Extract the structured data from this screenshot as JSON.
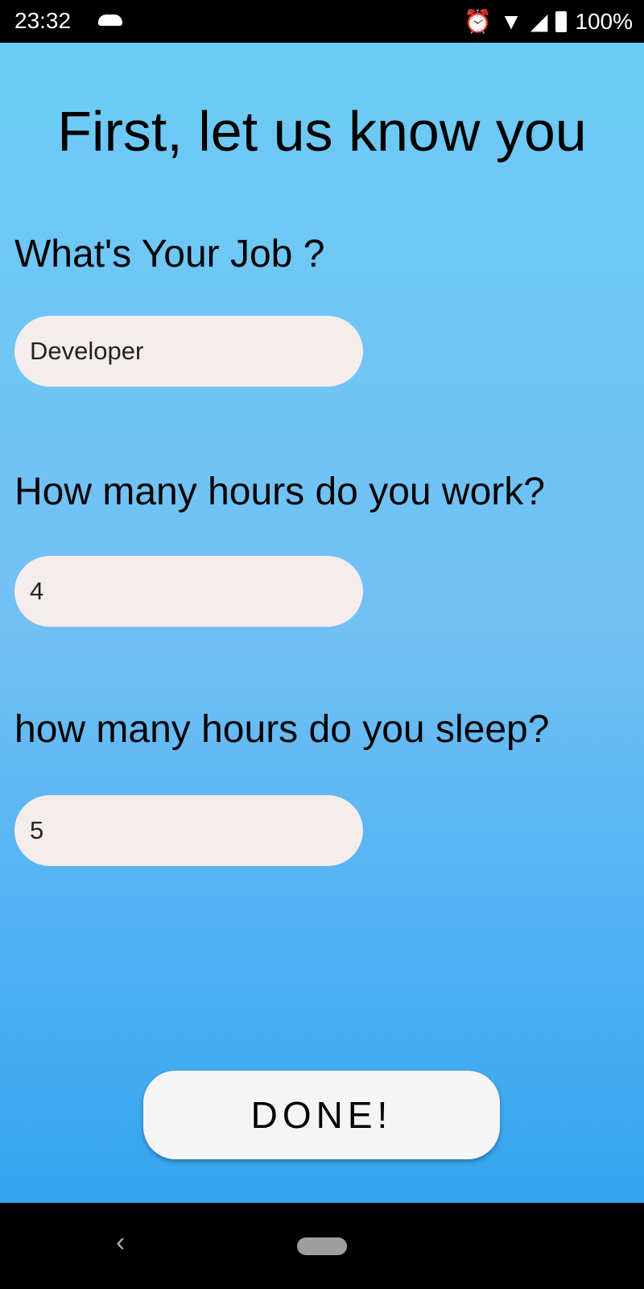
{
  "status": {
    "time": "23:32",
    "battery": "100%"
  },
  "title": "First, let us know you",
  "fields": [
    {
      "label": "What's Your Job ?",
      "value": "Developer"
    },
    {
      "label": "How many hours do you work?",
      "value": "4"
    },
    {
      "label": "how many hours do you sleep?",
      "value": "5"
    }
  ],
  "done_label": "DONE!"
}
